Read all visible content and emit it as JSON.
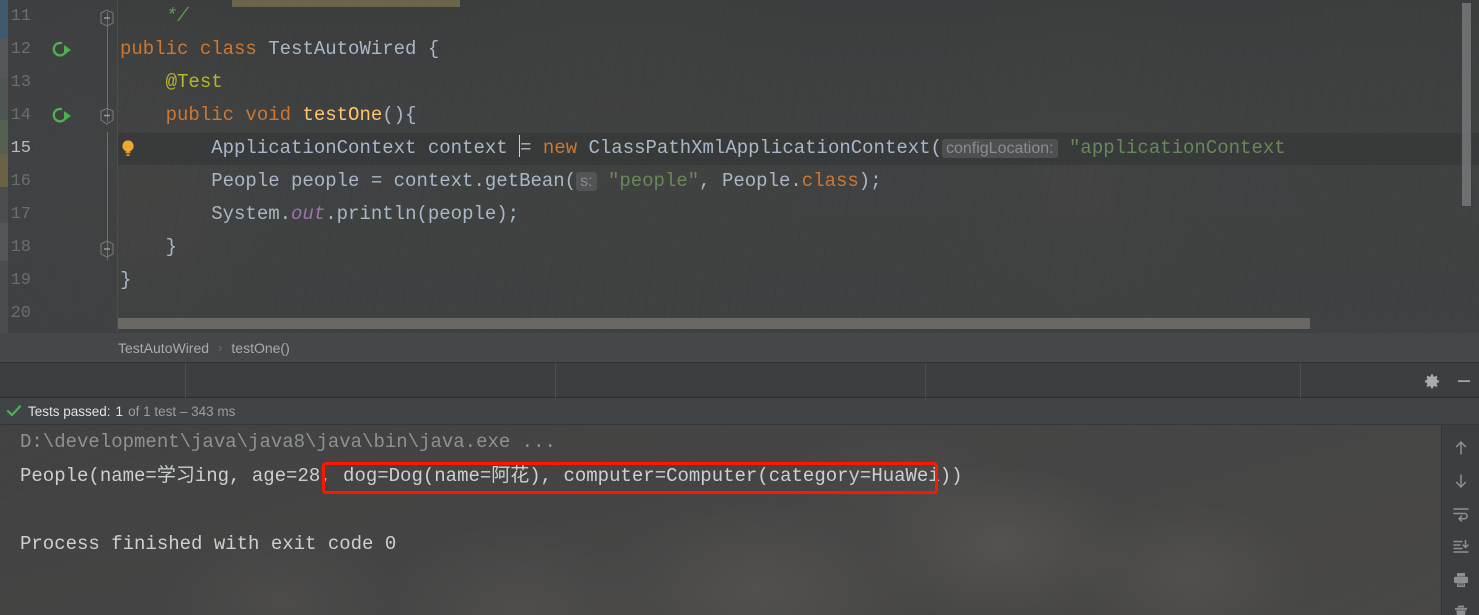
{
  "editor": {
    "line_numbers": [
      "11",
      "12",
      "13",
      "14",
      "15",
      "16",
      "17",
      "18",
      "19",
      "20"
    ],
    "current_line": "15",
    "run_marker_lines": [
      "12",
      "14"
    ],
    "lines": [
      {
        "num": "11",
        "tokens": [
          {
            "t": "    ",
            "c": "plain"
          },
          {
            "t": "*/",
            "c": "cmt"
          }
        ]
      },
      {
        "num": "12",
        "tokens": [
          {
            "t": "public class ",
            "c": "kw"
          },
          {
            "t": "TestAutoWired",
            "c": "cls"
          },
          {
            "t": " {",
            "c": "plain"
          }
        ]
      },
      {
        "num": "13",
        "tokens": [
          {
            "t": "    ",
            "c": "plain"
          },
          {
            "t": "@Test",
            "c": "anno"
          }
        ]
      },
      {
        "num": "14",
        "tokens": [
          {
            "t": "    ",
            "c": "plain"
          },
          {
            "t": "public void ",
            "c": "kw"
          },
          {
            "t": "testOne",
            "c": "meth"
          },
          {
            "t": "(){",
            "c": "plain"
          }
        ]
      },
      {
        "num": "15",
        "tokens": [
          {
            "t": "        ApplicationContext context ",
            "c": "plain"
          },
          {
            "t": "CARET",
            "c": "caret"
          },
          {
            "t": "= ",
            "c": "plain"
          },
          {
            "t": "new ",
            "c": "kw"
          },
          {
            "t": "ClassPathXmlApplicationContext(",
            "c": "plain"
          },
          {
            "t": "configLocation:",
            "c": "hint"
          },
          {
            "t": " ",
            "c": "plain"
          },
          {
            "t": "\"applicationContext",
            "c": "str"
          }
        ]
      },
      {
        "num": "16",
        "tokens": [
          {
            "t": "        People people = context.getBean(",
            "c": "plain"
          },
          {
            "t": "s:",
            "c": "hint"
          },
          {
            "t": " ",
            "c": "plain"
          },
          {
            "t": "\"people\"",
            "c": "str"
          },
          {
            "t": ", People.",
            "c": "plain"
          },
          {
            "t": "class",
            "c": "kw"
          },
          {
            "t": ");",
            "c": "plain"
          }
        ]
      },
      {
        "num": "17",
        "tokens": [
          {
            "t": "        System.",
            "c": "plain"
          },
          {
            "t": "out",
            "c": "stat"
          },
          {
            "t": ".println(people);",
            "c": "plain"
          }
        ]
      },
      {
        "num": "18",
        "tokens": [
          {
            "t": "    }",
            "c": "plain"
          }
        ]
      },
      {
        "num": "19",
        "tokens": [
          {
            "t": "}",
            "c": "plain"
          }
        ]
      },
      {
        "num": "20",
        "tokens": [
          {
            "t": "",
            "c": "plain"
          }
        ]
      }
    ],
    "colors": {
      "keyword": "#cc7832",
      "class_name": "#a9b7c6",
      "annotation": "#bbb529",
      "method": "#ffc66d",
      "string": "#6a8759",
      "comment": "#629755",
      "static_field": "#9876aa",
      "param_hint": "#8a8d8f",
      "background": "#454749"
    }
  },
  "breadcrumb": {
    "items": [
      "TestAutoWired",
      "testOne()"
    ],
    "separator": "›"
  },
  "toolwindow": {
    "settings_icon": "gear-icon",
    "minimize_icon": "minimize-icon"
  },
  "status": {
    "check_icon": "green-check-icon",
    "label": "Tests passed:",
    "count": "1",
    "detail": "of 1 test – 343 ms"
  },
  "console": {
    "lines": [
      {
        "text": "D:\\development\\java\\java8\\java\\bin\\java.exe ...",
        "style": "cmd"
      },
      {
        "text": "People(name=学习ing, age=28, dog=Dog(name=阿花), computer=Computer(category=HuaWei))",
        "style": "out"
      },
      {
        "text": "",
        "style": "out"
      },
      {
        "text": "Process finished with exit code 0",
        "style": "out"
      }
    ],
    "highlight": {
      "text": "dog=Dog(name=阿花), computer=Computer(category=HuaWei))",
      "color": "#ff1500"
    },
    "toolbar_icons": [
      "arrow-up-icon",
      "arrow-down-icon",
      "soft-wrap-icon",
      "scroll-to-end-icon",
      "print-icon",
      "trash-icon"
    ]
  }
}
